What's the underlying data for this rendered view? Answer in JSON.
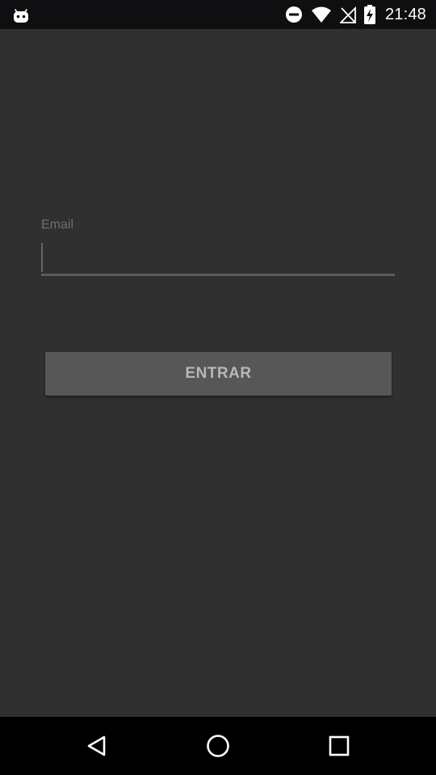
{
  "status_bar": {
    "time": "21:48",
    "icons": [
      "android-icon",
      "do-not-disturb-icon",
      "wifi-icon",
      "no-signal-icon",
      "battery-charging-icon"
    ]
  },
  "login": {
    "email_label": "Email",
    "email_value": "",
    "email_placeholder": "",
    "submit_label": "ENTRAR"
  },
  "nav_bar": {
    "icons": [
      "back-icon",
      "home-icon",
      "recents-icon"
    ]
  },
  "colors": {
    "background": "#303030",
    "status_bar": "#0f0f12",
    "button": "#575757",
    "button_text": "#b7b7b7",
    "label_text": "#6f6f6f"
  }
}
